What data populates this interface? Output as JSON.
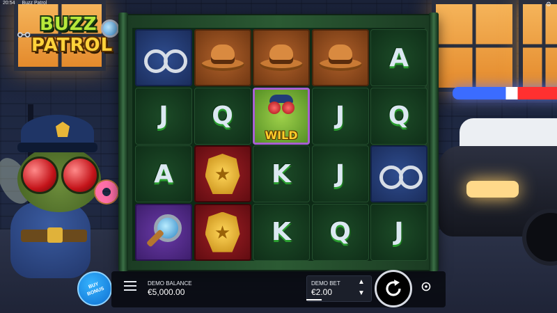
{
  "status": {
    "time": "20:54",
    "title": "Buzz Patrol"
  },
  "logo": {
    "line1": "BUZZ",
    "line2": "PATROL"
  },
  "grid": {
    "rows": [
      [
        {
          "symbol": "handcuffs",
          "bg": "blue"
        },
        {
          "symbol": "hat",
          "bg": "brown"
        },
        {
          "symbol": "hat",
          "bg": "brown"
        },
        {
          "symbol": "hat",
          "bg": "brown"
        },
        {
          "symbol": "A",
          "bg": "green"
        }
      ],
      [
        {
          "symbol": "J",
          "bg": "green"
        },
        {
          "symbol": "Q",
          "bg": "green"
        },
        {
          "symbol": "wild",
          "bg": "wild"
        },
        {
          "symbol": "J",
          "bg": "green"
        },
        {
          "symbol": "Q",
          "bg": "green"
        }
      ],
      [
        {
          "symbol": "A",
          "bg": "green"
        },
        {
          "symbol": "badge",
          "bg": "red"
        },
        {
          "symbol": "K",
          "bg": "green"
        },
        {
          "symbol": "J",
          "bg": "green"
        },
        {
          "symbol": "handcuffs",
          "bg": "blue"
        }
      ],
      [
        {
          "symbol": "magnifier",
          "bg": "purple"
        },
        {
          "symbol": "badge",
          "bg": "red"
        },
        {
          "symbol": "K",
          "bg": "green"
        },
        {
          "symbol": "Q",
          "bg": "green"
        },
        {
          "symbol": "J",
          "bg": "green"
        }
      ]
    ],
    "wild_label": "WILD"
  },
  "buy_bonus": {
    "label": "BUY\nBONUS"
  },
  "balance": {
    "label": "DEMO BALANCE",
    "value": "€5,000.00"
  },
  "bet": {
    "label": "DEMO BET",
    "value": "€2.00"
  },
  "icons": {
    "menu": "hamburger-menu-icon",
    "spin": "spin-arrow-icon",
    "auto": "autoplay-icon",
    "up": "chevron-up-icon",
    "down": "chevron-down-icon"
  }
}
